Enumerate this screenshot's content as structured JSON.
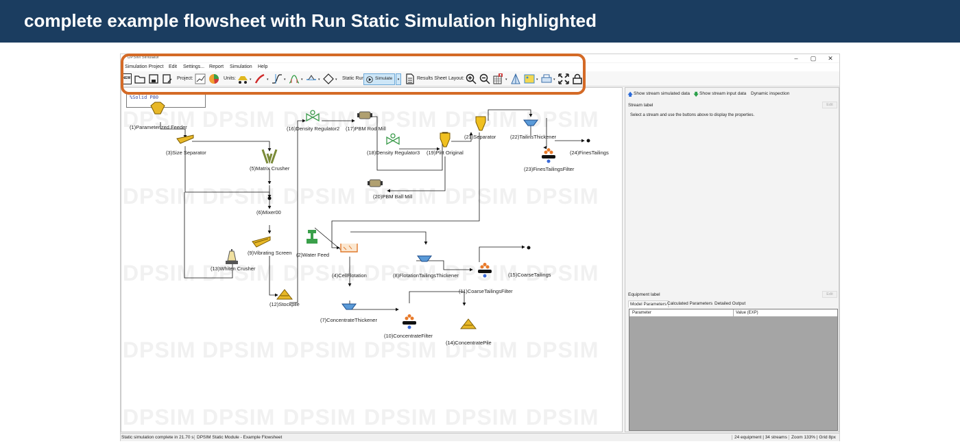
{
  "slide": {
    "title": "complete example flowsheet with Run Static Simulation highlighted"
  },
  "app": {
    "title": "DPSIM Simulator",
    "minimize": "–",
    "maximize": "▢",
    "close": "✕"
  },
  "menu": [
    "Simulation Project",
    "Edit",
    "Settings...",
    "Report",
    "Simulation",
    "Help"
  ],
  "toolbar": {
    "new_label": "NEW",
    "project_label": "Project:",
    "units_label": "Units:",
    "static_run_label": "Static Run",
    "simulate_label": "Simulate",
    "results_sheet_label": "Results Sheet",
    "layout_label": "Layout:"
  },
  "canvas": {
    "legend_line1": "",
    "legend_line2": "%Solid   P80",
    "watermark": "DPSIM",
    "equipment": [
      "(1)Parameterized Feeder",
      "(3)Size Separator",
      "(5)Matrix Crusher",
      "(6)Mixer00",
      "(9)Vibrating Screen",
      "(13)Whiten Crusher",
      "(12)Stockpile",
      "(16)Density Regulator2",
      "(17)PBM Rod Mill",
      "(18)Density Regulator3",
      "(19)Plitt Original",
      "(20)PBM Ball Mill",
      "(21)Separator",
      "(22)TailinsThickener",
      "(24)FinesTailings",
      "(23)FinesTailingsFilter",
      "(2)Water Feed",
      "(4)CellFlotation",
      "(8)FlotationTailingsThickener",
      "(11)CoarseTailingsFilter",
      "(15)CoarseTailings",
      "(7)ConcentrateThickener",
      "(10)ConcentrateFilter",
      "(14)ConcentratePile"
    ]
  },
  "side_panel": {
    "show_simulated": "Show stream simulated data",
    "show_input": "Show stream input data",
    "dynamic": "Dynamic inspection",
    "stream_label": "Stream label",
    "edit": "Edit",
    "hint": "Select a stream and use the buttons above to display the properties.",
    "equipment_label": "Equipment label",
    "tabs": [
      "Model Parameters",
      "Calculated Parameters",
      "Detailed Output"
    ],
    "col_parameter": "Parameter",
    "col_value": "Value (EXP)"
  },
  "status": {
    "left": "Static simulation complete in 21.70 s",
    "middle": "DPSIM Static Module - Example Flowsheet",
    "right": "24 equipment | 34 streams",
    "zoom": "Zoom 133% | Grid 8px"
  },
  "colors": {
    "header": "#1b3d60",
    "highlight": "#d46a26",
    "simulate_bg": "#cde6f7"
  }
}
